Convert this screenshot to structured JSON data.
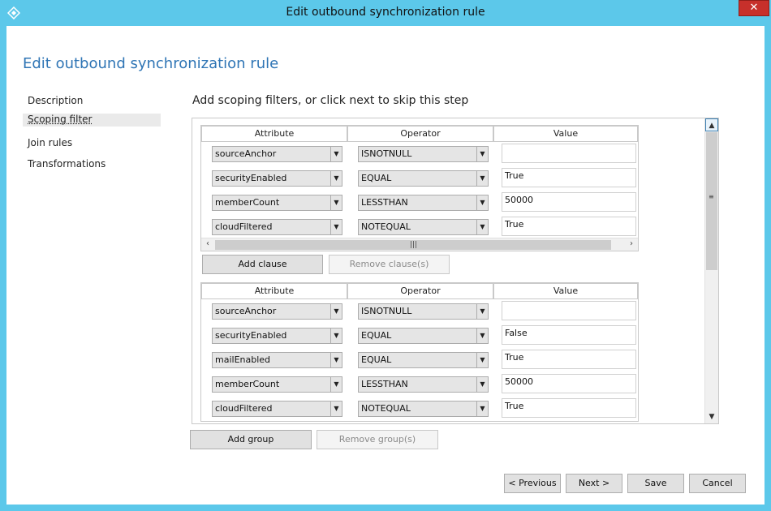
{
  "window": {
    "title": "Edit outbound synchronization rule",
    "close_glyph": "✕"
  },
  "page": {
    "heading": "Edit outbound synchronization rule",
    "step_instruction": "Add scoping filters, or click next to skip this step"
  },
  "nav": {
    "items": [
      {
        "label": "Description"
      },
      {
        "label": "Scoping filter",
        "active": true
      },
      {
        "label": "Join rules"
      },
      {
        "label": "Transformations"
      }
    ]
  },
  "table_headers": {
    "attribute": "Attribute",
    "operator": "Operator",
    "value": "Value"
  },
  "groups": [
    {
      "rows": [
        {
          "attribute": "sourceAnchor",
          "operator": "ISNOTNULL",
          "value": ""
        },
        {
          "attribute": "securityEnabled",
          "operator": "EQUAL",
          "value": "True"
        },
        {
          "attribute": "memberCount",
          "operator": "LESSTHAN",
          "value": "50000"
        },
        {
          "attribute": "cloudFiltered",
          "operator": "NOTEQUAL",
          "value": "True"
        }
      ]
    },
    {
      "rows": [
        {
          "attribute": "sourceAnchor",
          "operator": "ISNOTNULL",
          "value": ""
        },
        {
          "attribute": "securityEnabled",
          "operator": "EQUAL",
          "value": "False"
        },
        {
          "attribute": "mailEnabled",
          "operator": "EQUAL",
          "value": "True"
        },
        {
          "attribute": "memberCount",
          "operator": "LESSTHAN",
          "value": "50000"
        },
        {
          "attribute": "cloudFiltered",
          "operator": "NOTEQUAL",
          "value": "True"
        }
      ]
    }
  ],
  "buttons": {
    "add_clause": "Add clause",
    "remove_clause": "Remove clause(s)",
    "add_group": "Add group",
    "remove_group": "Remove group(s)",
    "previous": "< Previous",
    "next": "Next >",
    "save": "Save",
    "cancel": "Cancel"
  },
  "colors": {
    "titlebar": "#5cc8ea",
    "heading": "#2f75b5",
    "close": "#c7302b"
  },
  "icons": {
    "app": "azure-ad-connect-icon",
    "dropdown": "chevron-down-icon"
  }
}
